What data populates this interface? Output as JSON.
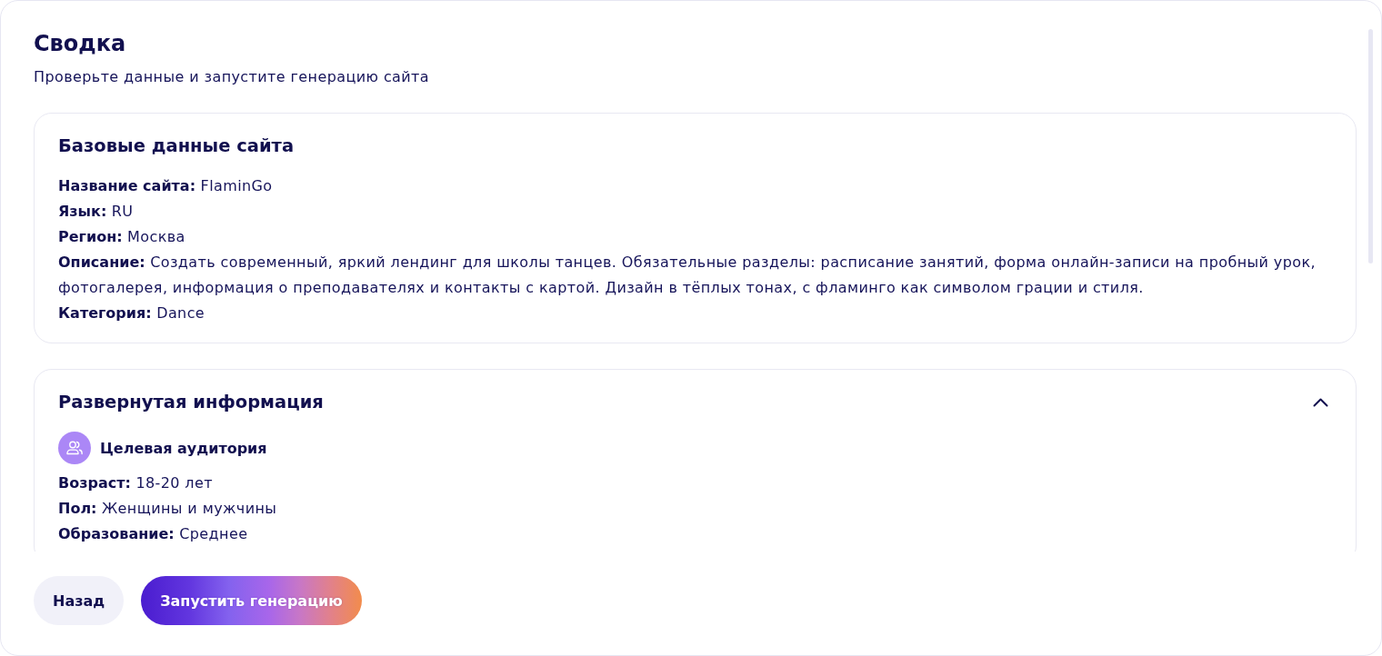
{
  "header": {
    "title": "Сводка",
    "subtitle": "Проверьте данные и запустите генерацию сайта"
  },
  "base_info": {
    "title": "Базовые данные сайта",
    "fields": [
      {
        "text": "**Название сайта:** FlaminGo"
      },
      {
        "text": "**Язык:** RU"
      },
      {
        "text": "**Регион:** Москва"
      },
      {
        "text": "**Описание:** Создать современный, яркий лендинг для школы танцев. Обязательные разделы: расписание занятий, форма онлайн-записи на пробный урок, фотогалерея, информация о преподавателях и контакты с картой. Дизайн в тёплых тонах, с фламинго как символом грации и стиля."
      },
      {
        "text": "**Категория:** Dance"
      }
    ]
  },
  "extended_info": {
    "title": "Развернутая информация",
    "expanded": true,
    "groups": [
      {
        "title": "Целевая аудитория",
        "fields": [
          {
            "text": "**Возраст:** 18-20 лет"
          },
          {
            "text": "**Пол:** Женщины и мужчины"
          },
          {
            "text": "**Образование:** Среднее"
          }
        ]
      }
    ]
  },
  "buttons": [
    {
      "label": "Назад",
      "kind": "secondary"
    },
    {
      "label": "Запустить генерацию",
      "kind": "primary"
    }
  ]
}
